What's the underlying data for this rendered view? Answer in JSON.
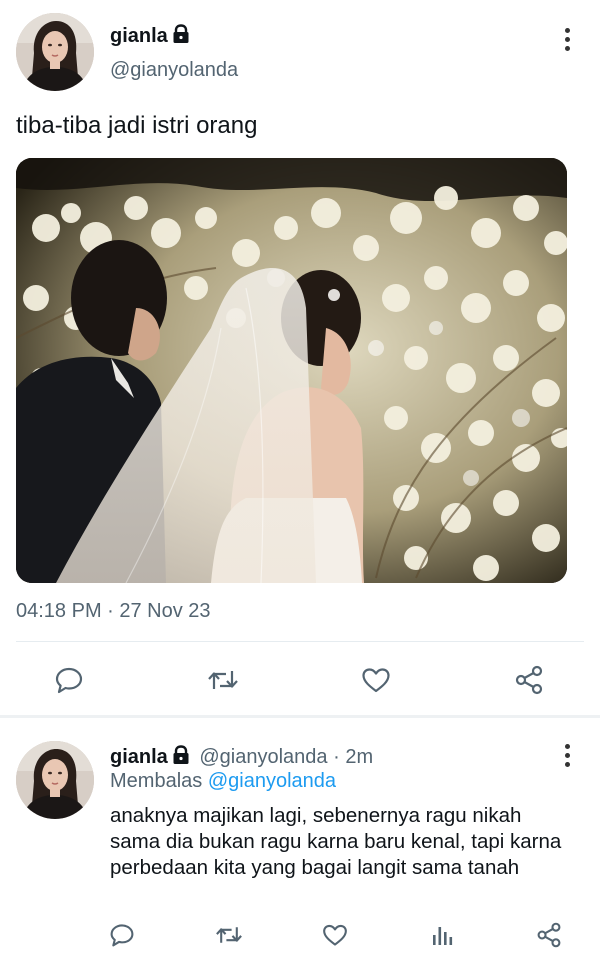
{
  "tweet": {
    "display_name": "gianla",
    "handle": "@gianyolanda",
    "text": "tiba-tiba jadi istri orang",
    "timestamp": "04:18 PM · 27 Nov 23",
    "avatar_icon": "profile-photo",
    "media_description": "photo",
    "actions": [
      "reply-icon",
      "retweet-icon",
      "like-icon",
      "share-icon"
    ]
  },
  "reply": {
    "display_name": "gianla",
    "handle": "@gianyolanda",
    "separator": "·",
    "time": "2m",
    "replying_prefix": "Membalas",
    "replying_handle": "@gianyolanda",
    "text": "anaknya majikan lagi, sebenernya ragu nikah sama dia bukan ragu karna baru kenal, tapi karna perbedaan kita yang bagai langit sama tanah",
    "actions": [
      "reply-icon",
      "retweet-icon",
      "like-icon",
      "analytics-icon",
      "share-icon"
    ]
  },
  "colors": {
    "text_primary": "#0f1419",
    "text_secondary": "#536471",
    "mention": "#1d9bf0",
    "icon": "#536471",
    "divider": "#e6ecf0"
  }
}
